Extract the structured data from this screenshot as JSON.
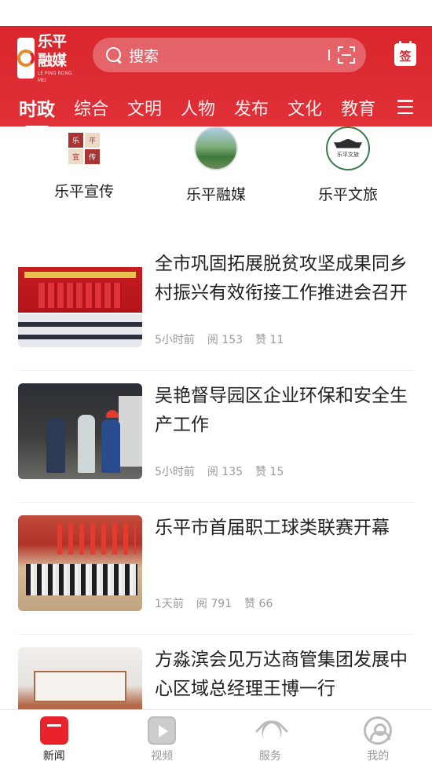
{
  "header": {
    "logo_text": "乐平融媒",
    "logo_subtext": "LE PING RONG MEI",
    "search_placeholder": "搜索",
    "signin_label": "签"
  },
  "tabs": [
    {
      "label": "时政",
      "active": true
    },
    {
      "label": "综合",
      "active": false
    },
    {
      "label": "文明",
      "active": false
    },
    {
      "label": "人物",
      "active": false
    },
    {
      "label": "发布",
      "active": false
    },
    {
      "label": "文化",
      "active": false
    },
    {
      "label": "教育",
      "active": false
    }
  ],
  "channels": [
    {
      "label": "乐平宣传",
      "icon": "leping-xuanchuan-logo",
      "logo_text": [
        "乐",
        "平",
        "宣",
        "传"
      ]
    },
    {
      "label": "乐平融媒",
      "icon": "leping-rongmei-logo"
    },
    {
      "label": "乐平文旅",
      "icon": "leping-wenlv-logo",
      "logo_text": "乐平文旅"
    }
  ],
  "news": [
    {
      "title": "全市巩固拓展脱贫攻坚成果同乡村振兴有效衔接工作推进会召开",
      "time": "5小时前",
      "reads": "阅 153",
      "likes": "赞 11"
    },
    {
      "title": "吴艳督导园区企业环保和安全生产工作",
      "time": "5小时前",
      "reads": "阅 135",
      "likes": "赞 15"
    },
    {
      "title": "乐平市首届职工球类联赛开幕",
      "time": "1天前",
      "reads": "阅 791",
      "likes": "赞 66"
    },
    {
      "title": "方淼滨会见万达商管集团发展中心区域总经理王博一行",
      "time": "",
      "reads": "",
      "likes": ""
    }
  ],
  "tabbar": [
    {
      "label": "新闻",
      "icon": "news-icon",
      "active": true
    },
    {
      "label": "视频",
      "icon": "video-icon",
      "active": false
    },
    {
      "label": "服务",
      "icon": "service-icon",
      "active": false
    },
    {
      "label": "我的",
      "icon": "profile-icon",
      "active": false
    }
  ],
  "colors": {
    "brand": "#d9262d",
    "text": "#222222",
    "meta": "#999999"
  }
}
